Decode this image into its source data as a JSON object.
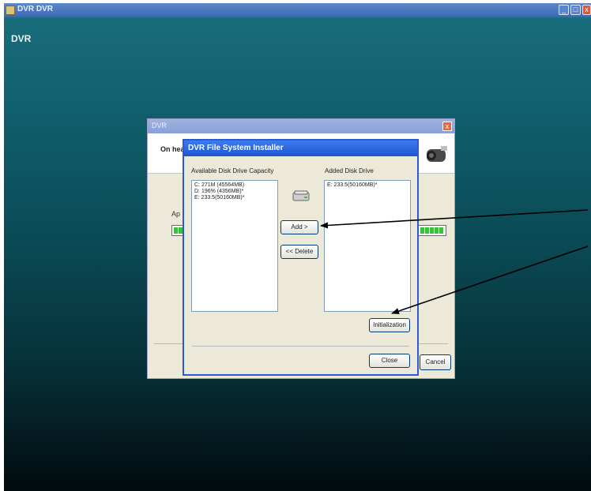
{
  "window": {
    "title": "DVR DVR",
    "heading": "DVR",
    "minimize_symbol": "_",
    "maximize_symbol": "□",
    "close_symbol": "x"
  },
  "background_dialog": {
    "title": "DVR",
    "close_symbol": "x",
    "header_text": "On hea",
    "progress_label": "Ap",
    "cancel_label": "Cancel"
  },
  "dialog": {
    "title": "DVR File System Installer",
    "available_label": "Available Disk Drive Capacity",
    "added_label": "Added Disk Drive",
    "available_items": [
      "C: 271M (45564MB)",
      "D: 196% (4356MB)*",
      "E: 233.5(50160MB)*"
    ],
    "added_items": [
      "E: 233.5(50160MB)*"
    ],
    "add_label": "Add >",
    "delete_label": "<< Delete",
    "init_label": "Initialization",
    "close_label": "Close"
  },
  "colors": {
    "accent": "#2a5bd7",
    "progress": "#3cbf3c"
  },
  "icons": [
    "app-icon",
    "camera-icon",
    "disk-drive-icon"
  ]
}
